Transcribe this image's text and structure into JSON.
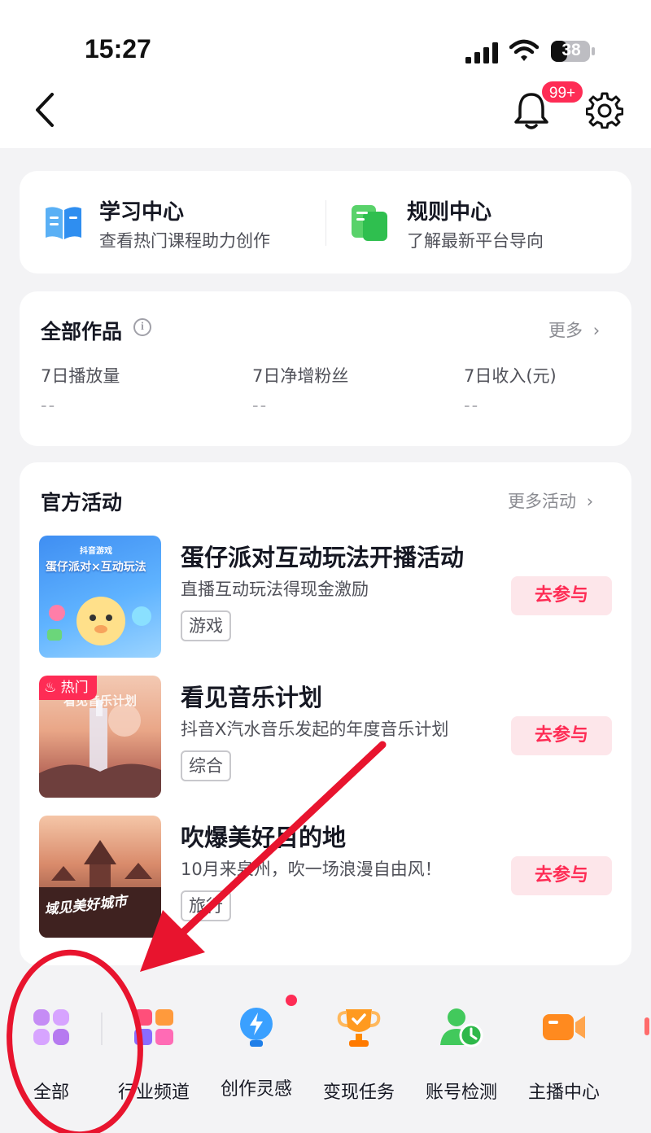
{
  "status_bar": {
    "time": "15:27",
    "battery": "38"
  },
  "header": {
    "notification_badge": "99+"
  },
  "learning": [
    {
      "title": "学习中心",
      "subtitle": "查看热门课程助力创作"
    },
    {
      "title": "规则中心",
      "subtitle": "了解最新平台导向"
    }
  ],
  "works": {
    "title": "全部作品",
    "more": "更多",
    "stats": [
      {
        "label": "7日播放量",
        "value": "--"
      },
      {
        "label": "7日净增粉丝",
        "value": "--"
      },
      {
        "label": "7日收入(元)",
        "value": "--"
      }
    ]
  },
  "events": {
    "title": "官方活动",
    "more": "更多活动",
    "items": [
      {
        "title": "蛋仔派对互动玩法开播活动",
        "desc": "直播互动玩法得现金激励",
        "tag": "游戏",
        "button": "去参与",
        "thumb_text": "蛋仔派对×互动玩法",
        "thumb_brand": "抖音游戏"
      },
      {
        "title": "看见音乐计划",
        "desc": "抖音X汽水音乐发起的年度音乐计划",
        "tag": "综合",
        "button": "去参与",
        "hot": "热门",
        "thumb_text": "看见音乐计划"
      },
      {
        "title": "吹爆美好目的地",
        "desc": "10月来泉州，吹一场浪漫自由风！",
        "tag": "旅行",
        "button": "去参与",
        "thumb_text": "域见美好城市"
      }
    ]
  },
  "tools": [
    {
      "label": "全部",
      "icon": "grid-icon"
    },
    {
      "label": "行业频道",
      "icon": "industry-channel-icon"
    },
    {
      "label": "创作灵感",
      "icon": "lightbulb-icon"
    },
    {
      "label": "变现任务",
      "icon": "trophy-icon"
    },
    {
      "label": "账号检测",
      "icon": "account-check-icon"
    },
    {
      "label": "主播中心",
      "icon": "camera-icon"
    }
  ],
  "colors": {
    "accent": "#fe2c55",
    "annotation": "#e8142e",
    "background": "#f3f3f5"
  }
}
